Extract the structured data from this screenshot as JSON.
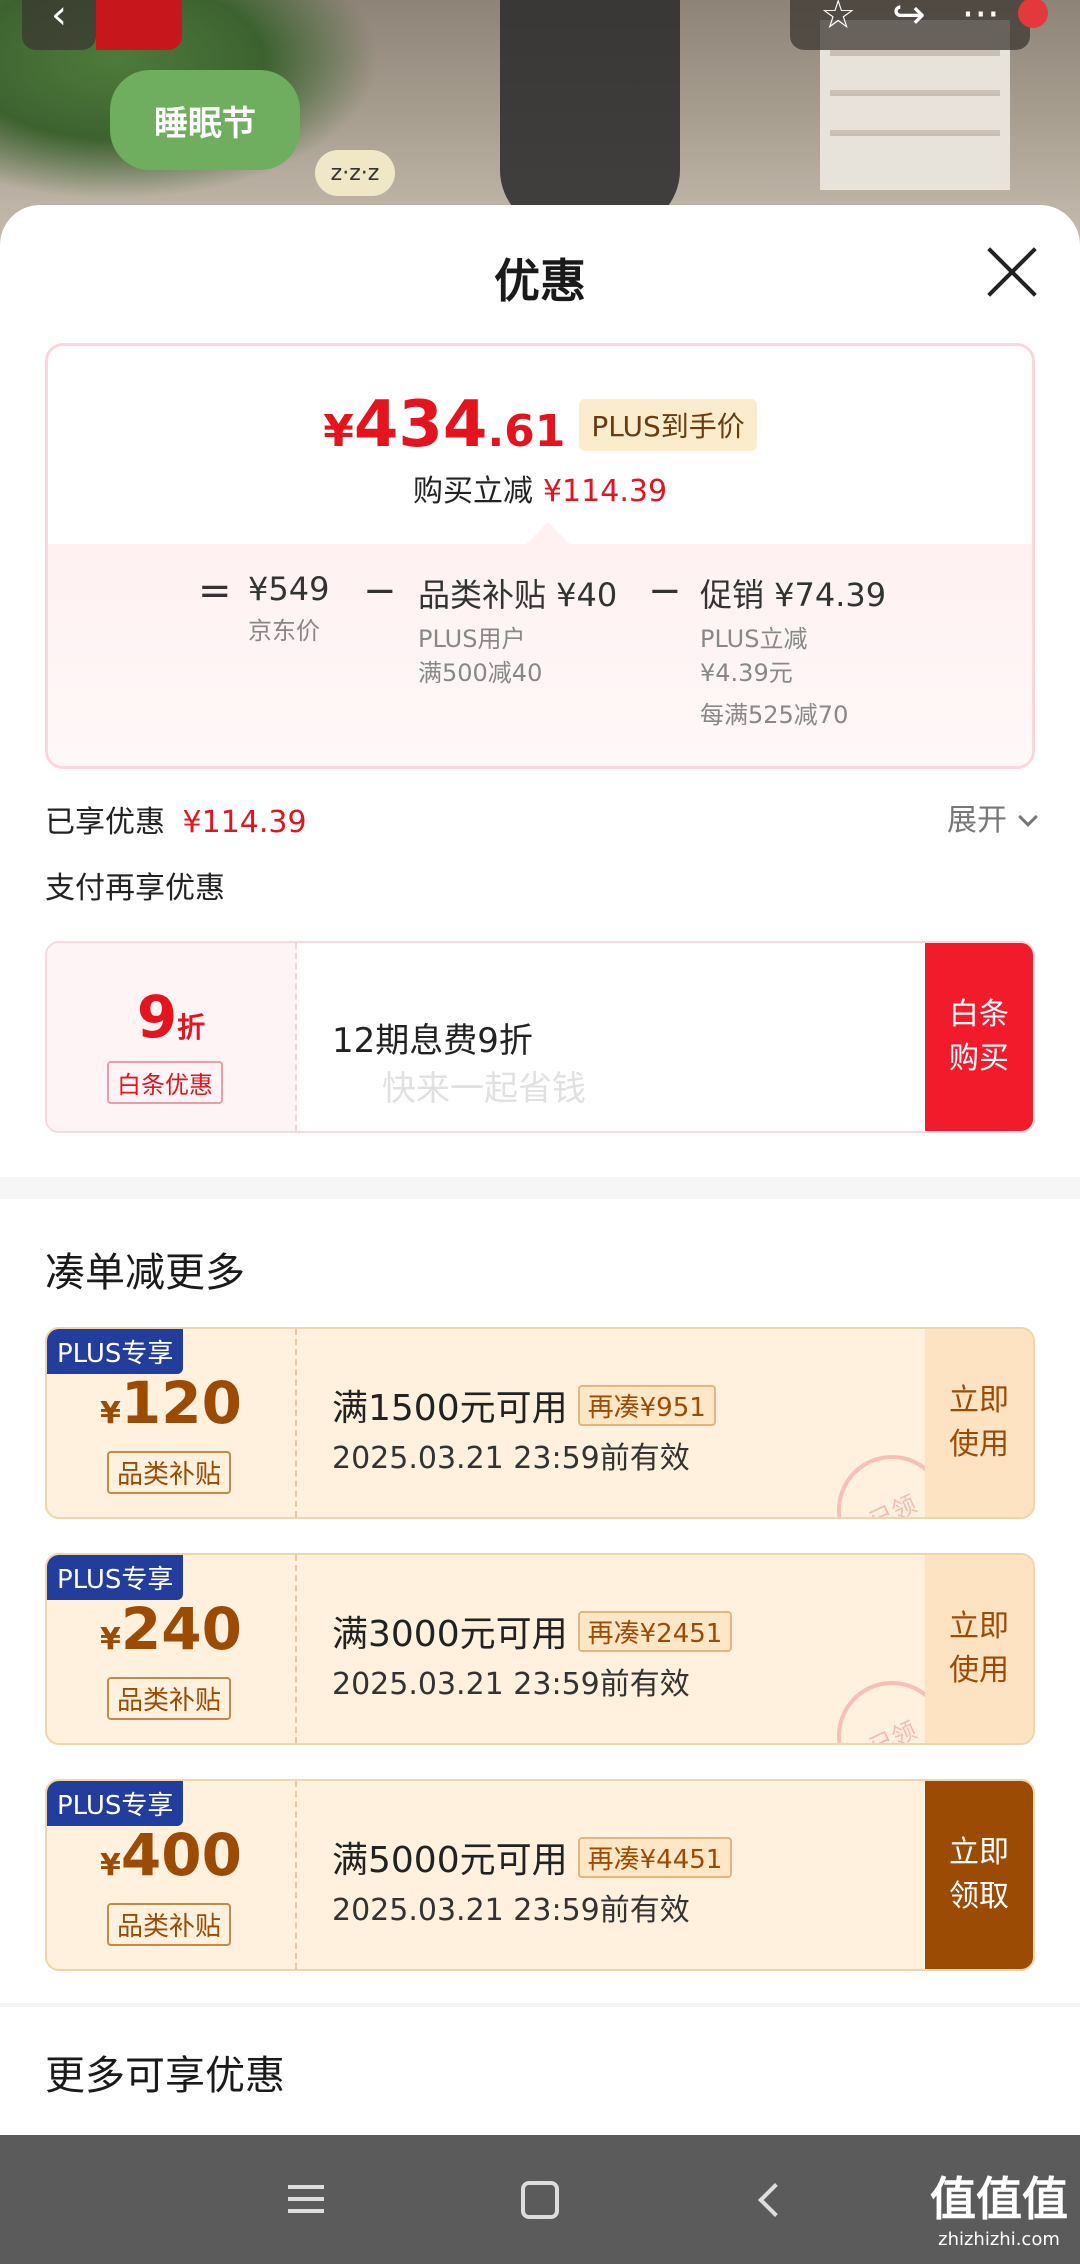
{
  "header": {
    "back_icon": "chevron-left-icon",
    "actions": [
      "star-icon",
      "share-icon",
      "more-icon"
    ],
    "badge_text": "睡眠节",
    "zzz_text": "z·z·z"
  },
  "sheet": {
    "title": "优惠",
    "close_icon": "close-icon"
  },
  "price": {
    "currency": "¥",
    "integer": "434",
    "decimal": ".61",
    "tag": "PLUS到手价",
    "cut_label": "购买立减",
    "cut_amount": "¥114.39"
  },
  "breakdown": {
    "op_equal": "=",
    "op_minus": "−",
    "jd_price": "¥549",
    "jd_price_label": "京东价",
    "subsidy": "品类补贴 ¥40",
    "subsidy_line1": "PLUS用户",
    "subsidy_line2": "满500减40",
    "promo": "促销 ¥74.39",
    "promo_line1": "PLUS立减",
    "promo_line2": "¥4.39元",
    "promo_line3": "每满525减70"
  },
  "enjoyed": {
    "label": "已享优惠",
    "amount": "¥114.39",
    "expand": "展开"
  },
  "pay": {
    "label": "支付再享优惠",
    "discount_num": "9",
    "discount_unit": "折",
    "tag": "白条优惠",
    "text": "12期息费9折",
    "watermark": "快来一起省钱",
    "button": "白条购买"
  },
  "more_section": {
    "title": "凑单减更多"
  },
  "coupons": [
    {
      "plus": "PLUS专享",
      "currency": "¥",
      "amount": "120",
      "tag": "品类补贴",
      "condition": "满1500元可用",
      "more": "再凑¥951",
      "valid": "2025.03.21 23:59前有效",
      "button": "立即使用",
      "stamp": "已领"
    },
    {
      "plus": "PLUS专享",
      "currency": "¥",
      "amount": "240",
      "tag": "品类补贴",
      "condition": "满3000元可用",
      "more": "再凑¥2451",
      "valid": "2025.03.21 23:59前有效",
      "button": "立即使用",
      "stamp": "已领"
    },
    {
      "plus": "PLUS专享",
      "currency": "¥",
      "amount": "400",
      "tag": "品类补贴",
      "condition": "满5000元可用",
      "more": "再凑¥4451",
      "valid": "2025.03.21 23:59前有效",
      "button": "立即领取"
    }
  ],
  "extra_section": {
    "title": "更多可享优惠"
  },
  "navbar": {
    "icons": [
      "menu-icon",
      "home-icon",
      "back-icon"
    ],
    "watermark": "值值值",
    "watermark_url": "zhizhizhi.com"
  },
  "colors": {
    "accent_red": "#e4141e",
    "coupon_brown": "#9c4b05",
    "plus_blue": "#233d9c"
  }
}
